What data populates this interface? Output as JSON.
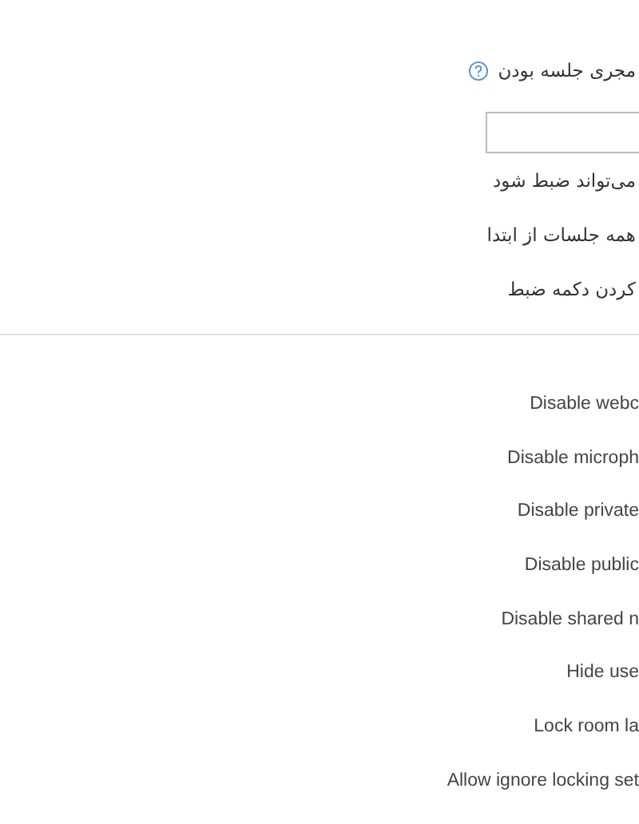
{
  "top_section": {
    "title": "مجری جلسه بودن",
    "options": [
      {
        "label": "می‌تواند ضبط شود"
      },
      {
        "label": "همه جلسات از ابتدا"
      },
      {
        "label": "کردن دکمه ضبط"
      }
    ]
  },
  "lock_settings": [
    {
      "label": "Disable webc"
    },
    {
      "label": "Disable microph"
    },
    {
      "label": "Disable private"
    },
    {
      "label": "Disable public"
    },
    {
      "label": "Disable shared n"
    },
    {
      "label": "Hide use"
    },
    {
      "label": "Lock room la"
    },
    {
      "label": "Allow ignore locking set"
    }
  ]
}
